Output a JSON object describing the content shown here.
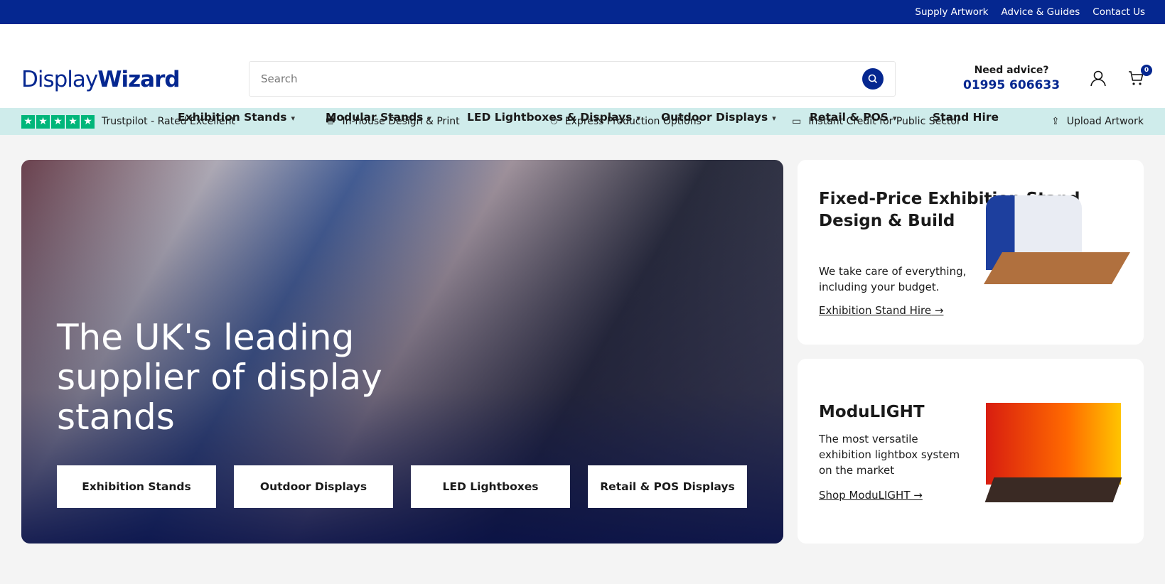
{
  "topbar": {
    "links": [
      "Supply Artwork",
      "Advice & Guides",
      "Contact Us"
    ]
  },
  "header": {
    "logo_light": "Display",
    "logo_bold": "Wizard",
    "search_placeholder": "Search",
    "advice_label": "Need advice?",
    "phone": "01995 606633",
    "cart_count": "0"
  },
  "nav": [
    {
      "label": "Exhibition Stands",
      "chevron": "▾"
    },
    {
      "label": "Modular Stands",
      "chevron": "▾"
    },
    {
      "label": "LED Lightboxes & Displays",
      "chevron": "▾"
    },
    {
      "label": "Outdoor Displays",
      "chevron": "▾"
    },
    {
      "label": "Retail & POS",
      "chevron": "▾"
    },
    {
      "label": "Stand Hire"
    }
  ],
  "usp": [
    "Trustpilot - Rated Excellent",
    "In-house Design & Print",
    "Express Production Options",
    "Instant Credit for Public Sector",
    "Upload Artwork"
  ],
  "hero": {
    "title": "The UK's leading supplier of display stands",
    "buttons": [
      "Exhibition Stands",
      "Outdoor Displays",
      "LED Lightboxes",
      "Retail & POS Displays"
    ]
  },
  "cards": [
    {
      "title": "Fixed-Price Exhibition Stand Design & Build",
      "text": "We take care of everything, including your budget.",
      "link": "Exhibition Stand Hire"
    },
    {
      "title": "ModuLIGHT",
      "text": "The most versatile exhibition lightbox system on the market",
      "link": "Shop ModuLIGHT"
    }
  ],
  "colors": {
    "brand": "#052790",
    "usp_bg": "#cfeceb",
    "trustpilot": "#00b67a"
  }
}
